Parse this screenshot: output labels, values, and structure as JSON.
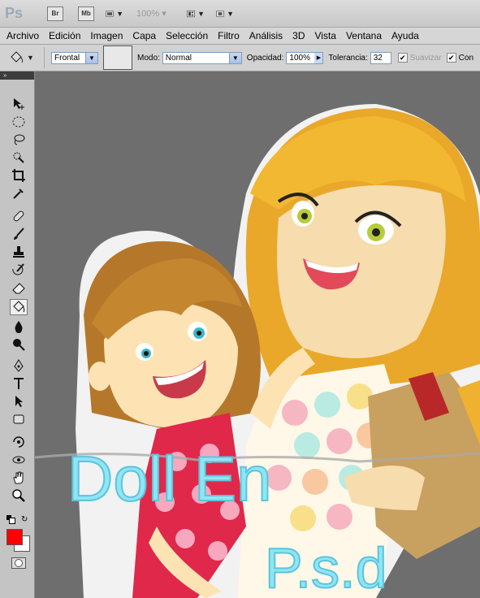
{
  "app": {
    "logo": "Ps",
    "bridge_label": "Br",
    "minibridge_label": "Mb",
    "zoom": "100%"
  },
  "menu": [
    "Archivo",
    "Edición",
    "Imagen",
    "Capa",
    "Selección",
    "Filtro",
    "Análisis",
    "3D",
    "Vista",
    "Ventana",
    "Ayuda"
  ],
  "options": {
    "fill_source": "Frontal",
    "mode_label": "Modo:",
    "mode_value": "Normal",
    "opacity_label": "Opacidad:",
    "opacity_value": "100%",
    "tolerance_label": "Tolerancia:",
    "tolerance_value": "32",
    "antialias_label": "Suavizar",
    "contiguous_label": "Con"
  },
  "colors": {
    "foreground": "#ff0000",
    "background": "#ffffff",
    "title_text": "#8fe6f2"
  },
  "canvas_text": {
    "line1": "Doll En",
    "line2": "P.s.d"
  },
  "tools": [
    "move-icon",
    "marquee-icon",
    "lasso-icon",
    "quick-select-icon",
    "crop-icon",
    "eyedropper-icon",
    "healing-icon",
    "brush-icon",
    "stamp-icon",
    "history-brush-icon",
    "eraser-icon",
    "paint-bucket-icon",
    "blur-icon",
    "dodge-icon",
    "pen-icon",
    "type-icon",
    "path-select-icon",
    "shape-icon",
    "3d-rotate-icon",
    "3d-orbit-icon",
    "hand-icon",
    "zoom-icon"
  ]
}
